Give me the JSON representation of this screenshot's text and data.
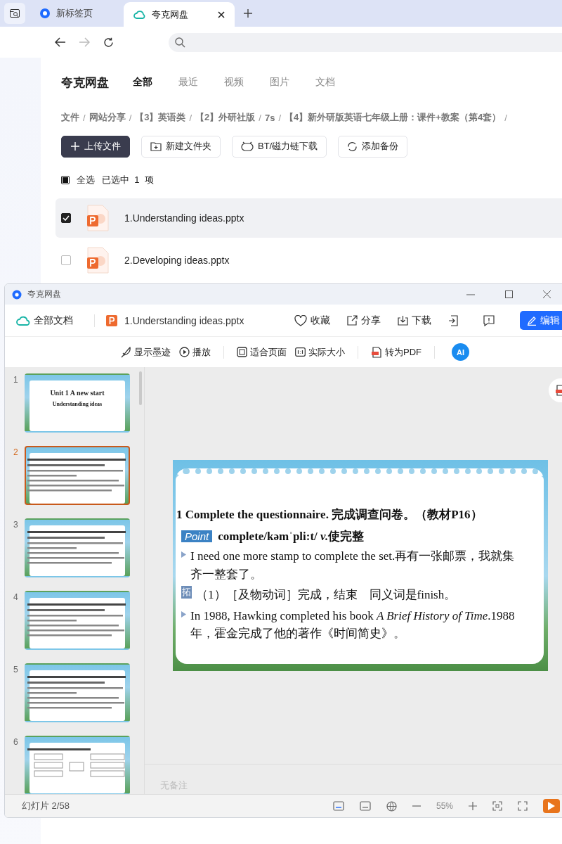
{
  "browser": {
    "tabs": [
      {
        "label": "新标签页",
        "selected": false
      },
      {
        "label": "夸克网盘",
        "selected": true
      }
    ]
  },
  "page": {
    "brand": "夸克网盘",
    "nav": [
      {
        "label": "全部",
        "selected": true
      },
      {
        "label": "最近",
        "selected": false
      },
      {
        "label": "视频",
        "selected": false
      },
      {
        "label": "图片",
        "selected": false
      },
      {
        "label": "文档",
        "selected": false
      }
    ],
    "breadcrumb": {
      "separator": "/",
      "items": [
        "文件",
        "网站分享",
        "【3】英语类",
        "【2】外研社版",
        "7s",
        "【4】新外研版英语七年级上册：课件+教案（第4套）"
      ]
    },
    "buttons": [
      "上传文件",
      "新建文件夹",
      "BT/磁力链下载",
      "添加备份"
    ],
    "select_all": {
      "label": "全选",
      "checked": false,
      "indeterminate": true,
      "count": "已选中  1  项"
    },
    "files": [
      {
        "name": "1.Understanding ideas.pptx",
        "checked": true
      },
      {
        "name": "2.Developing ideas.pptx",
        "checked": false
      }
    ]
  },
  "viewer": {
    "title": "夸克网盘",
    "all_docs": "全部文档",
    "file_name": "1.Understanding ideas.pptx",
    "actions": [
      "收藏",
      "分享",
      "下载"
    ],
    "edit": "编辑",
    "tools": [
      "显示墨迹",
      "播放",
      "适合页面",
      "实际大小",
      "转为PDF"
    ],
    "ai": "AI",
    "thumbnails": [
      {
        "number": "1",
        "selected": false,
        "kind": "title",
        "title": "Unit 1 A new start",
        "subtitle": "Understanding ideas"
      },
      {
        "number": "2",
        "selected": true,
        "kind": "text"
      },
      {
        "number": "3",
        "selected": false,
        "kind": "text"
      },
      {
        "number": "4",
        "selected": false,
        "kind": "text"
      },
      {
        "number": "5",
        "selected": false,
        "kind": "text"
      },
      {
        "number": "6",
        "selected": false,
        "kind": "diagram"
      }
    ],
    "slide": {
      "heading": "1 Complete the questionnaire. 完成调查问卷。（教材P16）",
      "badge": "Point",
      "term": "complete/kəmˈpli:t/ ",
      "pos": "v.",
      "meaning": "使完整",
      "lines": [
        {
          "kind": "bullet",
          "text": "I need one more stamp to complete the set.再有一张邮票，我就集齐一整套了。"
        },
        {
          "kind": "extend",
          "tag": "拓",
          "text": "（1）［及物动词］完成，结束　同义词是finish。"
        },
        {
          "kind": "bullet",
          "text": "In 1988, Hawking completed his book *A Brief History of Time*.1988年，霍金完成了他的著作《时间简史》。"
        }
      ]
    },
    "notes": "无备注",
    "status": "幻灯片 2/58",
    "zoom": "55%"
  }
}
